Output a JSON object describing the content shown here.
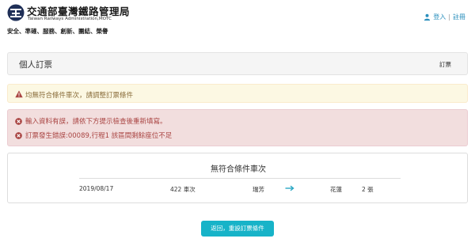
{
  "header": {
    "logo_title": "交通部臺灣鐵路管理局",
    "logo_subtitle": "Taiwan Railways Administration,MOTC",
    "slogan": "安全、準確、服務、創新、團結、榮譽",
    "login_label": "登入",
    "separator": "|",
    "register_label": "註冊"
  },
  "title_bar": {
    "title": "個人訂票",
    "breadcrumb": "訂票"
  },
  "alerts": {
    "warning": "均無符合條件車次，請調整訂票條件",
    "errors": [
      "輸入資料有誤，請依下方提示檢查後重新填寫。",
      "訂票發生錯誤:00089,行程1 該區間剩餘座位不足"
    ]
  },
  "result": {
    "heading": "無符合條件車次",
    "date": "2019/08/17",
    "train": "422 車次",
    "from": "瑞芳",
    "to": "花蓮",
    "tickets": "2 張"
  },
  "actions": {
    "back_button": "返回，重設訂票條件"
  },
  "colors": {
    "link": "#2a8fbd",
    "warning_bg": "#fcf8e3",
    "warning_text": "#8a6d3b",
    "error_bg": "#f2dede",
    "error_text": "#a94442",
    "button": "#17b3c8"
  },
  "icons": {
    "logo": "tra-logo-icon",
    "user": "user-icon",
    "warning": "warning-triangle-icon",
    "error": "x-circle-icon",
    "direction": "arrow-right-icon"
  }
}
